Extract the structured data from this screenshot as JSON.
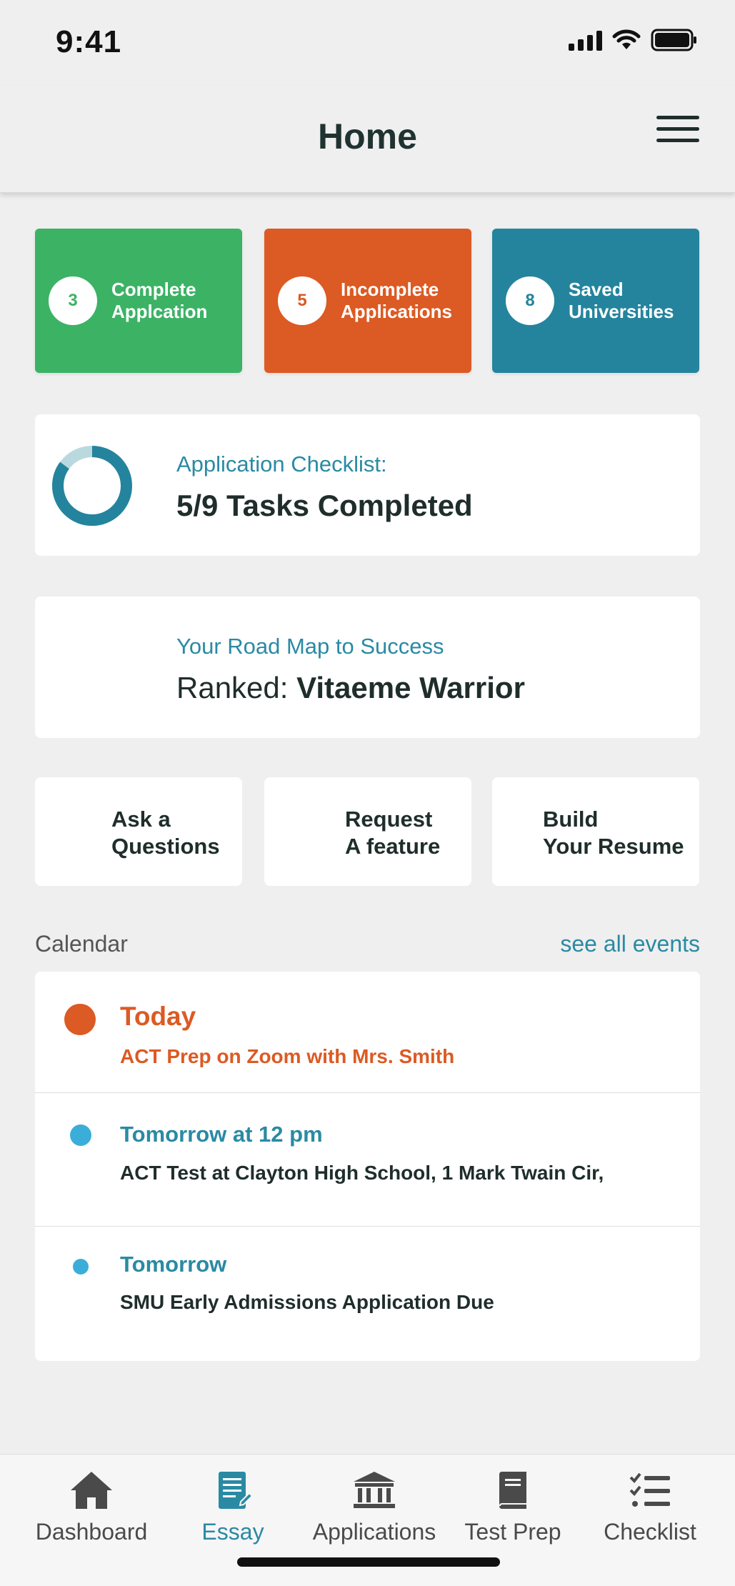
{
  "status_bar": {
    "time": "9:41"
  },
  "header": {
    "title": "Home"
  },
  "stats": [
    {
      "count": "3",
      "label": "Complete\nApplcation",
      "color": "#3cb265"
    },
    {
      "count": "5",
      "label": "Incomplete\nApplications",
      "color": "#dc5a23"
    },
    {
      "count": "8",
      "label": "Saved\nUniversities",
      "color": "#24849d"
    }
  ],
  "checklist": {
    "subtitle": "Application Checklist:",
    "title": "5/9 Tasks Completed",
    "completed": 5,
    "total": 9
  },
  "roadmap": {
    "subtitle": "Your Road Map to Success",
    "rank_prefix": "Ranked: ",
    "rank_name": "Vitaeme Warrior"
  },
  "actions": [
    {
      "label": "Ask a\nQuestions"
    },
    {
      "label": "Request\nA feature"
    },
    {
      "label": "Build\nYour Resume"
    }
  ],
  "calendar": {
    "label": "Calendar",
    "see_all": "see all events",
    "events": [
      {
        "when": "Today",
        "description": "ACT Prep on Zoom with Mrs. Smith",
        "color": "#dc5a23"
      },
      {
        "when": "Tomorrow at 12 pm",
        "description": "ACT Test at Clayton High School, 1 Mark Twain Cir,",
        "color": "#2a8aa3"
      },
      {
        "when": "Tomorrow",
        "description": "SMU Early Admissions Application Due",
        "color": "#2a8aa3"
      }
    ]
  },
  "tabs": [
    {
      "label": "Dashboard",
      "icon": "home-icon"
    },
    {
      "label": "Essay",
      "icon": "document-icon"
    },
    {
      "label": "Applications",
      "icon": "bank-icon"
    },
    {
      "label": "Test Prep",
      "icon": "book-icon"
    },
    {
      "label": "Checklist",
      "icon": "checklist-icon"
    }
  ],
  "colors": {
    "accent": "#2a8aa3",
    "event_dot": "#3aaed8",
    "today": "#dc5a23"
  }
}
